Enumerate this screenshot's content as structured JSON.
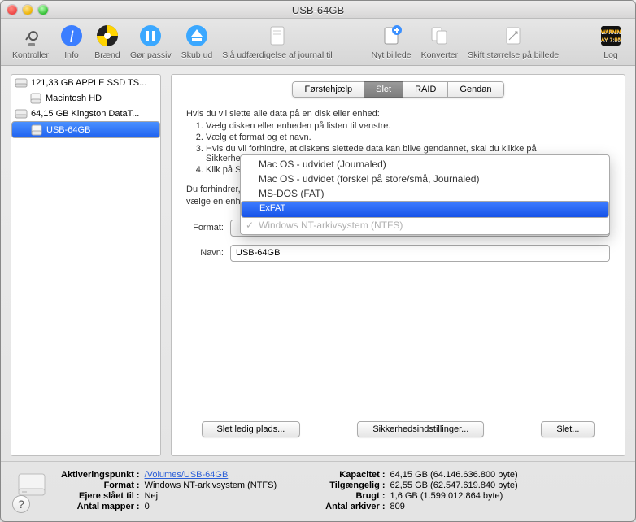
{
  "window_title": "USB-64GB",
  "toolbar": [
    {
      "id": "kontroller",
      "label": "Kontroller"
    },
    {
      "id": "info",
      "label": "Info"
    },
    {
      "id": "braend",
      "label": "Brænd"
    },
    {
      "id": "passiv",
      "label": "Gør passiv"
    },
    {
      "id": "skub",
      "label": "Skub ud"
    },
    {
      "id": "journal",
      "label": "Slå udfærdigelse af journal til"
    },
    {
      "id": "nyt",
      "label": "Nyt billede"
    },
    {
      "id": "konverter",
      "label": "Konverter"
    },
    {
      "id": "resize",
      "label": "Skift størrelse på billede"
    },
    {
      "id": "log",
      "label": "Log"
    }
  ],
  "sidebar": [
    {
      "label": "121,33 GB APPLE SSD TS...",
      "indent": 0,
      "type": "disk"
    },
    {
      "label": "Macintosh HD",
      "indent": 1,
      "type": "vol"
    },
    {
      "label": "64,15 GB Kingston DataT...",
      "indent": 0,
      "type": "disk"
    },
    {
      "label": "USB-64GB",
      "indent": 1,
      "type": "vol",
      "selected": true
    }
  ],
  "tabs": [
    "Førstehjælp",
    "Slet",
    "RAID",
    "Gendan"
  ],
  "active_tab": 1,
  "instructions": {
    "intro": "Hvis du vil slette alle data på en disk eller enhed:",
    "steps": [
      "Vælg disken eller enheden på listen til venstre.",
      "Vælg et format og et navn.",
      "Hvis du vil forhindre, at diskens slettede data kan blive gendannet, skal du klikke på Sikkerhedsindstillinger.",
      "Klik på Slet."
    ],
    "para2_a": "Du forhindrer, a",
    "para2_b": "vælge en enhed"
  },
  "format_options": [
    {
      "label": "Mac OS - udvidet (Journaled)"
    },
    {
      "label": "Mac OS - udvidet (forskel på store/små, Journaled)"
    },
    {
      "label": "MS-DOS (FAT)"
    },
    {
      "label": "ExFAT",
      "selected": true
    },
    {
      "label": "Windows NT-arkivsystem (NTFS)",
      "disabled": true,
      "current": true
    }
  ],
  "form": {
    "format_label": "Format:",
    "name_label": "Navn:",
    "name_value": "USB-64GB"
  },
  "buttons": {
    "free": "Slet ledig plads...",
    "security": "Sikkerhedsindstillinger...",
    "erase": "Slet..."
  },
  "footer": {
    "left": [
      {
        "k": "Aktiveringspunkt",
        "v": "/Volumes/USB-64GB",
        "link": true
      },
      {
        "k": "Format",
        "v": "Windows NT-arkivsystem (NTFS)"
      },
      {
        "k": "Ejere slået til",
        "v": "Nej"
      },
      {
        "k": "Antal mapper",
        "v": "0"
      }
    ],
    "right": [
      {
        "k": "Kapacitet",
        "v": "64,15 GB (64.146.636.800 byte)"
      },
      {
        "k": "Tilgængelig",
        "v": "62,55 GB (62.547.619.840 byte)"
      },
      {
        "k": "Brugt",
        "v": "1,6 GB (1.599.012.864 byte)"
      },
      {
        "k": "Antal arkiver",
        "v": "809"
      }
    ]
  }
}
